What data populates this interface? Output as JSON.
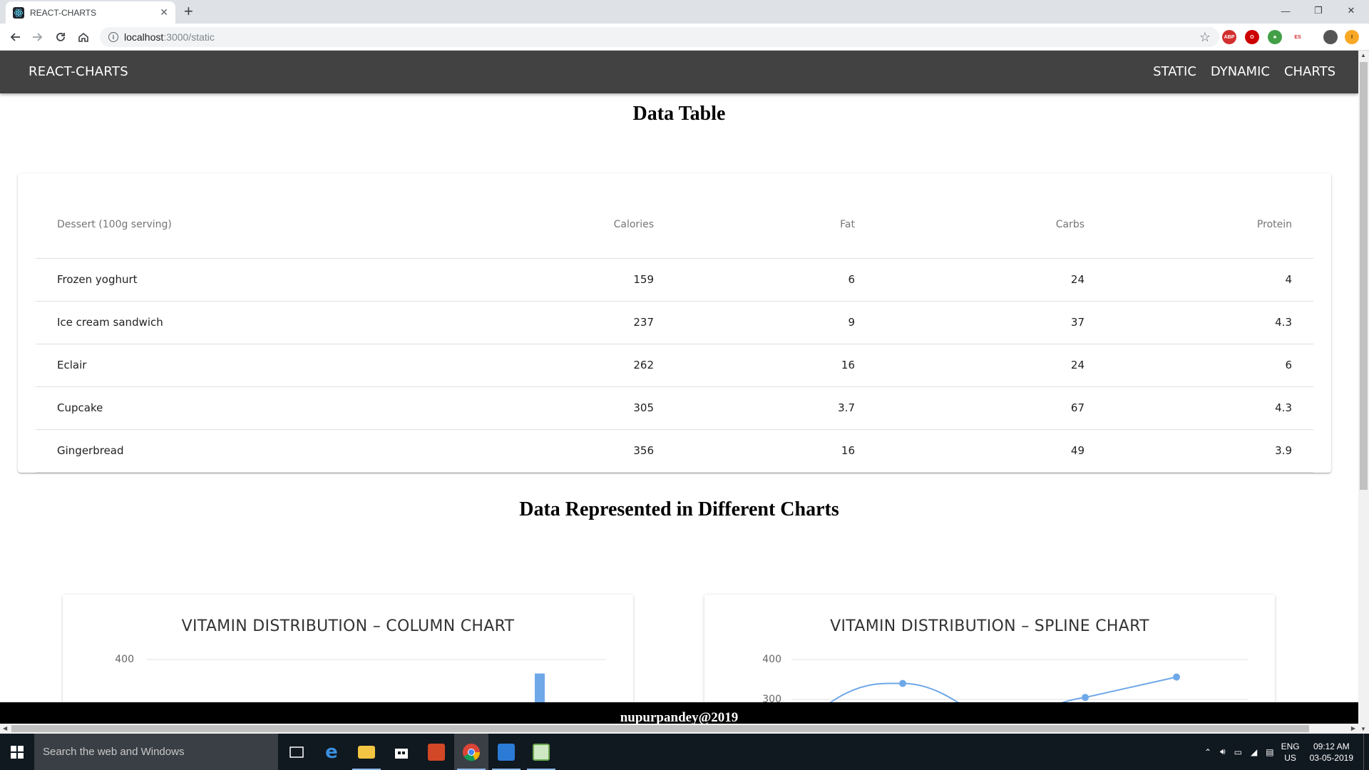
{
  "browser": {
    "tab_title": "REACT-CHARTS",
    "tab_close": "✕",
    "new_tab": "+",
    "url_host": "localhost",
    "url_path": ":3000/static",
    "window_min": "—",
    "window_restore": "❐",
    "window_close": "✕"
  },
  "app": {
    "brand": "REACT-CHARTS",
    "nav": [
      "STATIC",
      "DYNAMIC",
      "CHARTS"
    ]
  },
  "page": {
    "table_heading": "Data Table",
    "charts_heading": "Data Represented in Different Charts",
    "footer": "nupurpandey@2019"
  },
  "table": {
    "headers": [
      "Dessert (100g serving)",
      "Calories",
      "Fat",
      "Carbs",
      "Protein"
    ],
    "rows": [
      [
        "Frozen yoghurt",
        "159",
        "6",
        "24",
        "4"
      ],
      [
        "Ice cream sandwich",
        "237",
        "9",
        "37",
        "4.3"
      ],
      [
        "Eclair",
        "262",
        "16",
        "24",
        "6"
      ],
      [
        "Cupcake",
        "305",
        "3.7",
        "67",
        "4.3"
      ],
      [
        "Gingerbread",
        "356",
        "16",
        "49",
        "3.9"
      ]
    ]
  },
  "charts": {
    "column_title": "VITAMIN DISTRIBUTION – COLUMN CHART",
    "spline_title": "VITAMIN DISTRIBUTION – SPLINE CHART",
    "column_tick": "400",
    "spline_ticks": [
      "400",
      "300"
    ]
  },
  "chart_data": [
    {
      "type": "bar",
      "title": "VITAMIN DISTRIBUTION – COLUMN CHART",
      "yticks": [
        400
      ],
      "visible_bar_values": [
        365
      ],
      "color": "#6fa8e8"
    },
    {
      "type": "line",
      "title": "VITAMIN DISTRIBUTION – SPLINE CHART",
      "yticks": [
        400,
        300
      ],
      "visible_points": [
        {
          "x": 2,
          "y": 340
        },
        {
          "x": 4,
          "y": 305
        },
        {
          "x": 5,
          "y": 356
        }
      ],
      "color": "#6fa8e8"
    }
  ],
  "taskbar": {
    "search_placeholder": "Search the web and Windows",
    "lang_top": "ENG",
    "lang_bottom": "US",
    "time": "09:12 AM",
    "date": "03-05-2019"
  },
  "extensions": [
    "ABP",
    "ES"
  ]
}
